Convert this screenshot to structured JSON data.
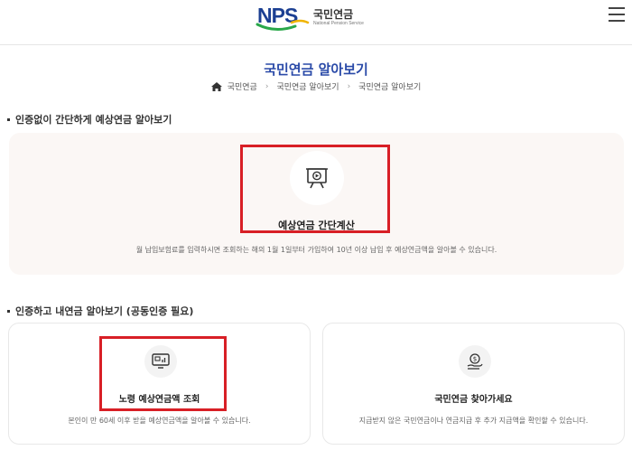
{
  "header": {
    "logo_mark": "NPS",
    "logo_name": "국민연금",
    "logo_sub": "National Pension Service"
  },
  "page_title": "국민연금 알아보기",
  "breadcrumb": [
    "국민연금",
    "국민연금 알아보기",
    "국민연금 알아보기"
  ],
  "section1": {
    "title": "인증없이 간단하게 예상연금 알아보기",
    "card": {
      "icon": "presentation-play-icon",
      "title": "예상연금 간단계산",
      "description": "월 납입보험료를 입력하시면 조회하는 해의 1월 1일부터 가입하여 10년 이상 납입 후 예상연금액을 알아볼 수 있습니다."
    }
  },
  "section2": {
    "title": "인증하고 내연금 알아보기 (공동인증 필요)",
    "cards": [
      {
        "icon": "monitor-chart-icon",
        "title": "노령 예상연금액 조회",
        "description": "본인이 만 60세 이후 받을 예상연금액을 알아볼 수 있습니다."
      },
      {
        "icon": "coin-hand-icon",
        "title": "국민연금 찾아가세요",
        "description": "지급받지 않은 국민연금이나 연금지급 후 추가 지급액을 확인할 수 있습니다."
      }
    ]
  },
  "colors": {
    "title_blue": "#2a4aa8",
    "highlight_red": "#d81f26",
    "card_bg": "#fbf7f5"
  }
}
